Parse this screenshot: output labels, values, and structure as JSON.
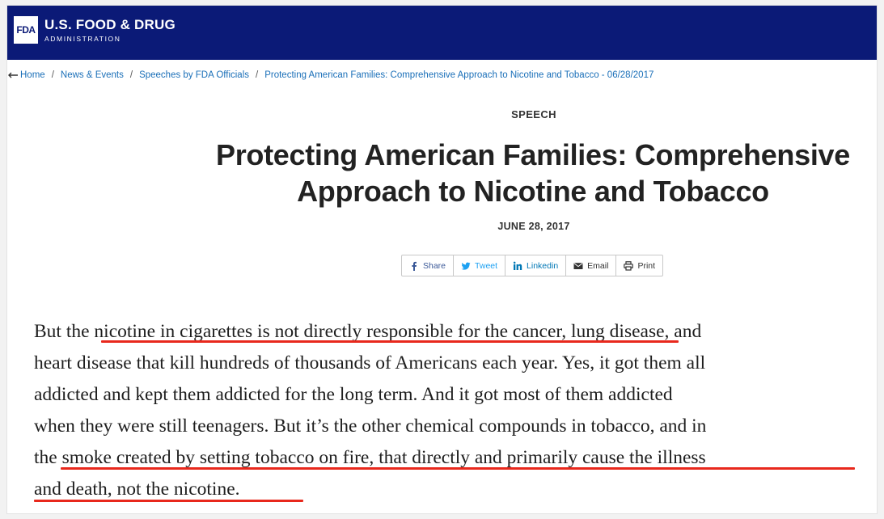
{
  "header": {
    "logo_text": "FDA",
    "title": "U.S. FOOD & DRUG",
    "subtitle": "ADMINISTRATION",
    "background_color": "#0b1a77"
  },
  "breadcrumb": {
    "icon": "back-arrow-icon",
    "items": [
      "Home",
      "News & Events",
      "Speeches by FDA Officials",
      "Protecting American Families: Comprehensive Approach to Nicotine and Tobacco - 06/28/2017"
    ],
    "separator": "/"
  },
  "article": {
    "eyebrow": "SPEECH",
    "title_line1": "Protecting American Families: Comprehensive",
    "title_line2": "Approach to Nicotine and Tobacco",
    "date": "JUNE 28, 2017"
  },
  "share": {
    "facebook": "Share",
    "twitter": "Tweet",
    "linkedin": "Linkedin",
    "email": "Email",
    "print": "Print"
  },
  "quote": {
    "lines": [
      "But the nicotine in cigarettes is not directly responsible for the cancer, lung disease, and",
      "heart disease that kill hundreds of thousands of Americans each year.  Yes, it got them all",
      "addicted and kept them addicted for the long term.  And it got most of them addicted",
      "when they were still teenagers.  But it’s the other chemical compounds in tobacco, and in",
      "the smoke created by setting tobacco on fire, that directly and primarily cause the illness",
      "and death, not the nicotine."
    ],
    "highlight_color": "#e8281c"
  }
}
